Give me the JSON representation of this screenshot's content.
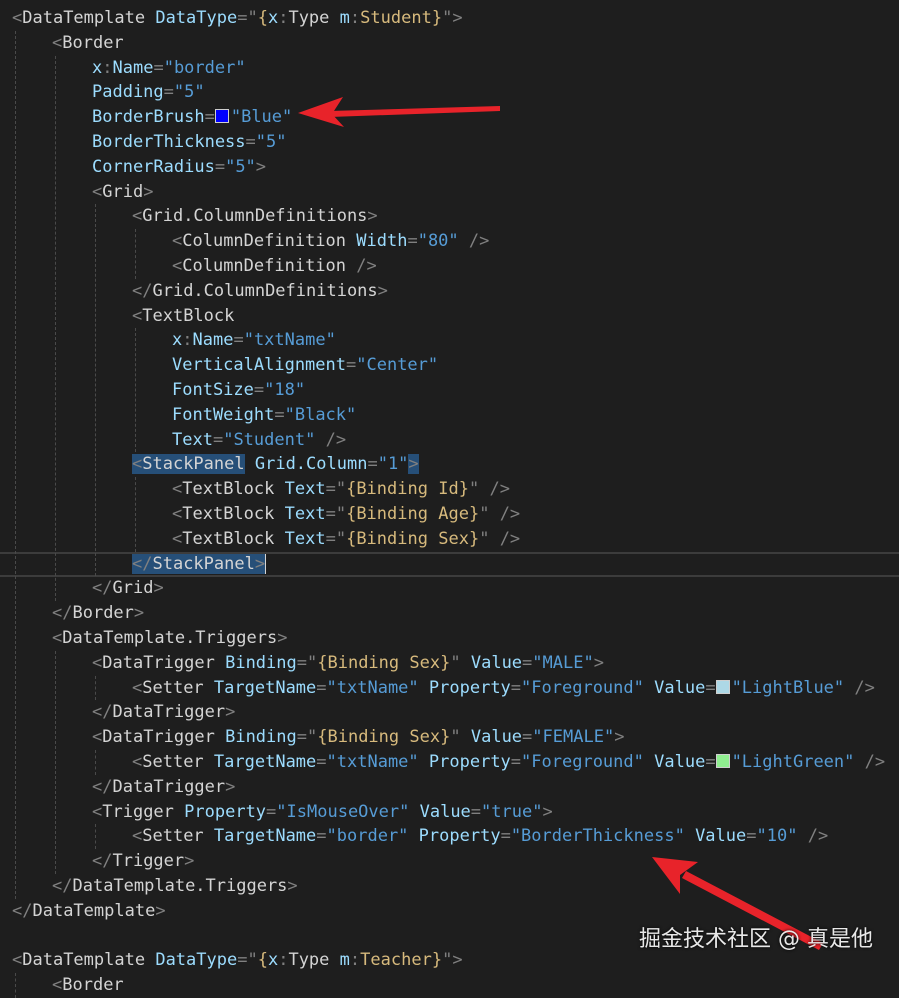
{
  "colors": {
    "background": "#1e1e1e",
    "attribute": "#9cdcfe",
    "string": "#569cd6",
    "element": "#d4d4d4",
    "punctuation": "#808080",
    "markup_extension": "#d7ba7d",
    "selection": "#264f78",
    "arrow": "#e8232a"
  },
  "watermark": "掘金技术社区 @ 真是他",
  "code": [
    {
      "indent": 0,
      "tokens": [
        [
          "p",
          "<"
        ],
        [
          "e",
          "DataTemplate"
        ],
        [
          "s",
          " "
        ],
        [
          "a",
          "DataType"
        ],
        [
          "p",
          "=\""
        ],
        [
          "x",
          "{"
        ],
        [
          "a",
          "x"
        ],
        [
          "p",
          ":"
        ],
        [
          "e",
          "Type"
        ],
        [
          "s",
          " "
        ],
        [
          "a",
          "m"
        ],
        [
          "p",
          ":"
        ],
        [
          "x",
          "Student"
        ],
        [
          "x",
          "}"
        ],
        [
          "p",
          "\""
        ],
        [
          "p",
          ">"
        ]
      ]
    },
    {
      "indent": 1,
      "tokens": [
        [
          "p",
          "<"
        ],
        [
          "e",
          "Border"
        ]
      ]
    },
    {
      "indent": 2,
      "tokens": [
        [
          "a",
          "x"
        ],
        [
          "p",
          ":"
        ],
        [
          "a",
          "Name"
        ],
        [
          "p",
          "="
        ],
        [
          "v",
          "\"border\""
        ]
      ]
    },
    {
      "indent": 2,
      "tokens": [
        [
          "a",
          "Padding"
        ],
        [
          "p",
          "="
        ],
        [
          "v",
          "\"5\""
        ]
      ]
    },
    {
      "indent": 2,
      "tokens": [
        [
          "a",
          "BorderBrush"
        ],
        [
          "p",
          "="
        ],
        [
          "sw",
          "#0000ff"
        ],
        [
          "v",
          "\"Blue\""
        ]
      ]
    },
    {
      "indent": 2,
      "tokens": [
        [
          "a",
          "BorderThickness"
        ],
        [
          "p",
          "="
        ],
        [
          "v",
          "\"5\""
        ]
      ]
    },
    {
      "indent": 2,
      "tokens": [
        [
          "a",
          "CornerRadius"
        ],
        [
          "p",
          "="
        ],
        [
          "v",
          "\"5\""
        ],
        [
          "p",
          ">"
        ]
      ]
    },
    {
      "indent": 2,
      "tokens": [
        [
          "p",
          "<"
        ],
        [
          "e",
          "Grid"
        ],
        [
          "p",
          ">"
        ]
      ]
    },
    {
      "indent": 3,
      "tokens": [
        [
          "p",
          "<"
        ],
        [
          "e",
          "Grid.ColumnDefinitions"
        ],
        [
          "p",
          ">"
        ]
      ]
    },
    {
      "indent": 4,
      "tokens": [
        [
          "p",
          "<"
        ],
        [
          "e",
          "ColumnDefinition"
        ],
        [
          "s",
          " "
        ],
        [
          "a",
          "Width"
        ],
        [
          "p",
          "="
        ],
        [
          "v",
          "\"80\""
        ],
        [
          "s",
          " "
        ],
        [
          "p",
          "/>"
        ]
      ]
    },
    {
      "indent": 4,
      "tokens": [
        [
          "p",
          "<"
        ],
        [
          "e",
          "ColumnDefinition"
        ],
        [
          "s",
          " "
        ],
        [
          "p",
          "/>"
        ]
      ]
    },
    {
      "indent": 3,
      "tokens": [
        [
          "p",
          "</"
        ],
        [
          "e",
          "Grid.ColumnDefinitions"
        ],
        [
          "p",
          ">"
        ]
      ]
    },
    {
      "indent": 3,
      "tokens": [
        [
          "p",
          "<"
        ],
        [
          "e",
          "TextBlock"
        ]
      ]
    },
    {
      "indent": 4,
      "tokens": [
        [
          "a",
          "x"
        ],
        [
          "p",
          ":"
        ],
        [
          "a",
          "Name"
        ],
        [
          "p",
          "="
        ],
        [
          "v",
          "\"txtName\""
        ]
      ]
    },
    {
      "indent": 4,
      "tokens": [
        [
          "a",
          "VerticalAlignment"
        ],
        [
          "p",
          "="
        ],
        [
          "v",
          "\"Center\""
        ]
      ]
    },
    {
      "indent": 4,
      "tokens": [
        [
          "a",
          "FontSize"
        ],
        [
          "p",
          "="
        ],
        [
          "v",
          "\"18\""
        ]
      ]
    },
    {
      "indent": 4,
      "tokens": [
        [
          "a",
          "FontWeight"
        ],
        [
          "p",
          "="
        ],
        [
          "v",
          "\"Black\""
        ]
      ]
    },
    {
      "indent": 4,
      "tokens": [
        [
          "a",
          "Text"
        ],
        [
          "p",
          "="
        ],
        [
          "v",
          "\"Student\""
        ],
        [
          "s",
          " "
        ],
        [
          "p",
          "/>"
        ]
      ]
    },
    {
      "indent": 3,
      "tokens": [
        [
          "hp",
          "<"
        ],
        [
          "he",
          "StackPanel"
        ],
        [
          "s",
          " "
        ],
        [
          "a",
          "Grid.Column"
        ],
        [
          "p",
          "="
        ],
        [
          "v",
          "\"1\""
        ],
        [
          "hp",
          ">"
        ]
      ]
    },
    {
      "indent": 4,
      "tokens": [
        [
          "p",
          "<"
        ],
        [
          "e",
          "TextBlock"
        ],
        [
          "s",
          " "
        ],
        [
          "a",
          "Text"
        ],
        [
          "p",
          "=\""
        ],
        [
          "x",
          "{"
        ],
        [
          "x",
          "Binding"
        ],
        [
          "s",
          " "
        ],
        [
          "x",
          "Id"
        ],
        [
          "x",
          "}"
        ],
        [
          "p",
          "\""
        ],
        [
          "s",
          " "
        ],
        [
          "p",
          "/>"
        ]
      ]
    },
    {
      "indent": 4,
      "tokens": [
        [
          "p",
          "<"
        ],
        [
          "e",
          "TextBlock"
        ],
        [
          "s",
          " "
        ],
        [
          "a",
          "Text"
        ],
        [
          "p",
          "=\""
        ],
        [
          "x",
          "{"
        ],
        [
          "x",
          "Binding"
        ],
        [
          "s",
          " "
        ],
        [
          "x",
          "Age"
        ],
        [
          "x",
          "}"
        ],
        [
          "p",
          "\""
        ],
        [
          "s",
          " "
        ],
        [
          "p",
          "/>"
        ]
      ]
    },
    {
      "indent": 4,
      "tokens": [
        [
          "p",
          "<"
        ],
        [
          "e",
          "TextBlock"
        ],
        [
          "s",
          " "
        ],
        [
          "a",
          "Text"
        ],
        [
          "p",
          "=\""
        ],
        [
          "x",
          "{"
        ],
        [
          "x",
          "Binding"
        ],
        [
          "s",
          " "
        ],
        [
          "x",
          "Sex"
        ],
        [
          "x",
          "}"
        ],
        [
          "p",
          "\""
        ],
        [
          "s",
          " "
        ],
        [
          "p",
          "/>"
        ]
      ]
    },
    {
      "indent": 3,
      "current": true,
      "tokens": [
        [
          "hp",
          "</"
        ],
        [
          "he",
          "StackPanel"
        ],
        [
          "hp",
          ">"
        ],
        [
          "c",
          ""
        ]
      ]
    },
    {
      "indent": 2,
      "tokens": [
        [
          "p",
          "</"
        ],
        [
          "e",
          "Grid"
        ],
        [
          "p",
          ">"
        ]
      ]
    },
    {
      "indent": 1,
      "tokens": [
        [
          "p",
          "</"
        ],
        [
          "e",
          "Border"
        ],
        [
          "p",
          ">"
        ]
      ]
    },
    {
      "indent": 1,
      "tokens": [
        [
          "p",
          "<"
        ],
        [
          "e",
          "DataTemplate.Triggers"
        ],
        [
          "p",
          ">"
        ]
      ]
    },
    {
      "indent": 2,
      "tokens": [
        [
          "p",
          "<"
        ],
        [
          "e",
          "DataTrigger"
        ],
        [
          "s",
          " "
        ],
        [
          "a",
          "Binding"
        ],
        [
          "p",
          "=\""
        ],
        [
          "x",
          "{"
        ],
        [
          "x",
          "Binding"
        ],
        [
          "s",
          " "
        ],
        [
          "x",
          "Sex"
        ],
        [
          "x",
          "}"
        ],
        [
          "p",
          "\""
        ],
        [
          "s",
          " "
        ],
        [
          "a",
          "Value"
        ],
        [
          "p",
          "="
        ],
        [
          "v",
          "\"MALE\""
        ],
        [
          "p",
          ">"
        ]
      ]
    },
    {
      "indent": 3,
      "tokens": [
        [
          "p",
          "<"
        ],
        [
          "e",
          "Setter"
        ],
        [
          "s",
          " "
        ],
        [
          "a",
          "TargetName"
        ],
        [
          "p",
          "="
        ],
        [
          "v",
          "\"txtName\""
        ],
        [
          "s",
          " "
        ],
        [
          "a",
          "Property"
        ],
        [
          "p",
          "="
        ],
        [
          "v",
          "\"Foreground\""
        ],
        [
          "s",
          " "
        ],
        [
          "a",
          "Value"
        ],
        [
          "p",
          "="
        ],
        [
          "sw",
          "#add8e6"
        ],
        [
          "v",
          "\"LightBlue\""
        ],
        [
          "s",
          " "
        ],
        [
          "p",
          "/>"
        ]
      ]
    },
    {
      "indent": 2,
      "tokens": [
        [
          "p",
          "</"
        ],
        [
          "e",
          "DataTrigger"
        ],
        [
          "p",
          ">"
        ]
      ]
    },
    {
      "indent": 2,
      "tokens": [
        [
          "p",
          "<"
        ],
        [
          "e",
          "DataTrigger"
        ],
        [
          "s",
          " "
        ],
        [
          "a",
          "Binding"
        ],
        [
          "p",
          "=\""
        ],
        [
          "x",
          "{"
        ],
        [
          "x",
          "Binding"
        ],
        [
          "s",
          " "
        ],
        [
          "x",
          "Sex"
        ],
        [
          "x",
          "}"
        ],
        [
          "p",
          "\""
        ],
        [
          "s",
          " "
        ],
        [
          "a",
          "Value"
        ],
        [
          "p",
          "="
        ],
        [
          "v",
          "\"FEMALE\""
        ],
        [
          "p",
          ">"
        ]
      ]
    },
    {
      "indent": 3,
      "tokens": [
        [
          "p",
          "<"
        ],
        [
          "e",
          "Setter"
        ],
        [
          "s",
          " "
        ],
        [
          "a",
          "TargetName"
        ],
        [
          "p",
          "="
        ],
        [
          "v",
          "\"txtName\""
        ],
        [
          "s",
          " "
        ],
        [
          "a",
          "Property"
        ],
        [
          "p",
          "="
        ],
        [
          "v",
          "\"Foreground\""
        ],
        [
          "s",
          " "
        ],
        [
          "a",
          "Value"
        ],
        [
          "p",
          "="
        ],
        [
          "sw",
          "#90ee90"
        ],
        [
          "v",
          "\"LightGreen\""
        ],
        [
          "s",
          " "
        ],
        [
          "p",
          "/>"
        ]
      ]
    },
    {
      "indent": 2,
      "tokens": [
        [
          "p",
          "</"
        ],
        [
          "e",
          "DataTrigger"
        ],
        [
          "p",
          ">"
        ]
      ]
    },
    {
      "indent": 2,
      "tokens": [
        [
          "p",
          "<"
        ],
        [
          "e",
          "Trigger"
        ],
        [
          "s",
          " "
        ],
        [
          "a",
          "Property"
        ],
        [
          "p",
          "="
        ],
        [
          "v",
          "\"IsMouseOver\""
        ],
        [
          "s",
          " "
        ],
        [
          "a",
          "Value"
        ],
        [
          "p",
          "="
        ],
        [
          "v",
          "\"true\""
        ],
        [
          "p",
          ">"
        ]
      ]
    },
    {
      "indent": 3,
      "tokens": [
        [
          "p",
          "<"
        ],
        [
          "e",
          "Setter"
        ],
        [
          "s",
          " "
        ],
        [
          "a",
          "TargetName"
        ],
        [
          "p",
          "="
        ],
        [
          "v",
          "\"border\""
        ],
        [
          "s",
          " "
        ],
        [
          "a",
          "Property"
        ],
        [
          "p",
          "="
        ],
        [
          "v",
          "\"BorderThickness\""
        ],
        [
          "s",
          " "
        ],
        [
          "a",
          "Value"
        ],
        [
          "p",
          "="
        ],
        [
          "v",
          "\"10\""
        ],
        [
          "s",
          " "
        ],
        [
          "p",
          "/>"
        ]
      ]
    },
    {
      "indent": 2,
      "tokens": [
        [
          "p",
          "</"
        ],
        [
          "e",
          "Trigger"
        ],
        [
          "p",
          ">"
        ]
      ]
    },
    {
      "indent": 1,
      "tokens": [
        [
          "p",
          "</"
        ],
        [
          "e",
          "DataTemplate.Triggers"
        ],
        [
          "p",
          ">"
        ]
      ]
    },
    {
      "indent": 0,
      "tokens": [
        [
          "p",
          "</"
        ],
        [
          "e",
          "DataTemplate"
        ],
        [
          "p",
          ">"
        ]
      ]
    },
    {
      "indent": 0,
      "tokens": []
    },
    {
      "indent": 0,
      "tokens": [
        [
          "p",
          "<"
        ],
        [
          "e",
          "DataTemplate"
        ],
        [
          "s",
          " "
        ],
        [
          "a",
          "DataType"
        ],
        [
          "p",
          "=\""
        ],
        [
          "x",
          "{"
        ],
        [
          "a",
          "x"
        ],
        [
          "p",
          ":"
        ],
        [
          "e",
          "Type"
        ],
        [
          "s",
          " "
        ],
        [
          "a",
          "m"
        ],
        [
          "p",
          ":"
        ],
        [
          "x",
          "Teacher"
        ],
        [
          "x",
          "}"
        ],
        [
          "p",
          "\""
        ],
        [
          "p",
          ">"
        ]
      ]
    },
    {
      "indent": 1,
      "tokens": [
        [
          "p",
          "<"
        ],
        [
          "e",
          "Border"
        ]
      ]
    }
  ]
}
